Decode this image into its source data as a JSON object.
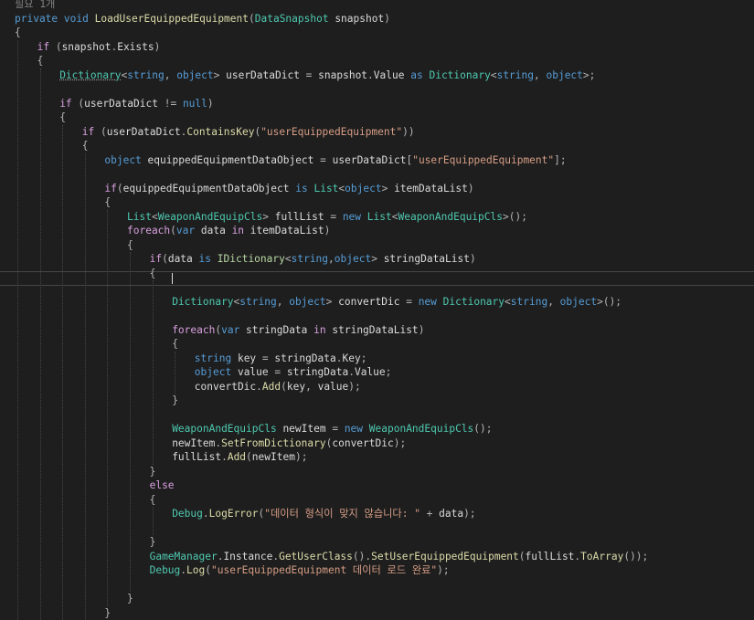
{
  "editor": {
    "lines": [
      {
        "n": 0,
        "indent": 0,
        "tokens": [
          {
            "t": "필요 1개",
            "c": "comment"
          }
        ]
      },
      {
        "n": 1,
        "indent": 0,
        "tokens": [
          {
            "t": "private",
            "c": "kw"
          },
          {
            "t": " ",
            "c": "txt"
          },
          {
            "t": "void",
            "c": "kw"
          },
          {
            "t": " ",
            "c": "txt"
          },
          {
            "t": "LoadUserEquippedEquipment",
            "c": "mth"
          },
          {
            "t": "(",
            "c": "pun"
          },
          {
            "t": "DataSnapshot",
            "c": "type"
          },
          {
            "t": " snapshot",
            "c": "var"
          },
          {
            "t": ")",
            "c": "pun"
          }
        ]
      },
      {
        "n": 2,
        "indent": 0,
        "tokens": [
          {
            "t": "{",
            "c": "pun"
          }
        ]
      },
      {
        "n": 3,
        "indent": 1,
        "tokens": [
          {
            "t": "if",
            "c": "ctl"
          },
          {
            "t": " (",
            "c": "pun"
          },
          {
            "t": "snapshot",
            "c": "var"
          },
          {
            "t": ".",
            "c": "pun"
          },
          {
            "t": "Exists",
            "c": "prop"
          },
          {
            "t": ")",
            "c": "pun"
          }
        ]
      },
      {
        "n": 4,
        "indent": 1,
        "tokens": [
          {
            "t": "{",
            "c": "pun"
          }
        ]
      },
      {
        "n": 5,
        "indent": 2,
        "tokens": [
          {
            "t": "Dictionary",
            "c": "type-sq"
          },
          {
            "t": "<",
            "c": "pun"
          },
          {
            "t": "string",
            "c": "kw"
          },
          {
            "t": ", ",
            "c": "pun"
          },
          {
            "t": "object",
            "c": "kw"
          },
          {
            "t": "> ",
            "c": "pun"
          },
          {
            "t": "userDataDict",
            "c": "var"
          },
          {
            "t": " = ",
            "c": "pun"
          },
          {
            "t": "snapshot",
            "c": "var"
          },
          {
            "t": ".",
            "c": "pun"
          },
          {
            "t": "Value",
            "c": "prop"
          },
          {
            "t": " ",
            "c": "txt"
          },
          {
            "t": "as",
            "c": "kw"
          },
          {
            "t": " ",
            "c": "txt"
          },
          {
            "t": "Dictionary",
            "c": "type"
          },
          {
            "t": "<",
            "c": "pun"
          },
          {
            "t": "string",
            "c": "kw"
          },
          {
            "t": ", ",
            "c": "pun"
          },
          {
            "t": "object",
            "c": "kw"
          },
          {
            "t": ">;",
            "c": "pun"
          }
        ]
      },
      {
        "n": 6,
        "indent": 2,
        "tokens": []
      },
      {
        "n": 7,
        "indent": 2,
        "tokens": [
          {
            "t": "if",
            "c": "ctl"
          },
          {
            "t": " (",
            "c": "pun"
          },
          {
            "t": "userDataDict",
            "c": "var"
          },
          {
            "t": " != ",
            "c": "pun"
          },
          {
            "t": "null",
            "c": "kw"
          },
          {
            "t": ")",
            "c": "pun"
          }
        ]
      },
      {
        "n": 8,
        "indent": 2,
        "tokens": [
          {
            "t": "{",
            "c": "pun"
          }
        ]
      },
      {
        "n": 9,
        "indent": 3,
        "tokens": [
          {
            "t": "if",
            "c": "ctl"
          },
          {
            "t": " (",
            "c": "pun"
          },
          {
            "t": "userDataDict",
            "c": "var"
          },
          {
            "t": ".",
            "c": "pun"
          },
          {
            "t": "ContainsKey",
            "c": "mth"
          },
          {
            "t": "(",
            "c": "pun"
          },
          {
            "t": "\"userEquippedEquipment\"",
            "c": "str"
          },
          {
            "t": "))",
            "c": "pun"
          }
        ]
      },
      {
        "n": 10,
        "indent": 3,
        "tokens": [
          {
            "t": "{",
            "c": "pun"
          }
        ]
      },
      {
        "n": 11,
        "indent": 4,
        "tokens": [
          {
            "t": "object",
            "c": "kw"
          },
          {
            "t": " equippedEquipmentDataObject",
            "c": "var"
          },
          {
            "t": " = ",
            "c": "pun"
          },
          {
            "t": "userDataDict",
            "c": "var"
          },
          {
            "t": "[",
            "c": "pun"
          },
          {
            "t": "\"userEquippedEquipment\"",
            "c": "str"
          },
          {
            "t": "];",
            "c": "pun"
          }
        ]
      },
      {
        "n": 12,
        "indent": 4,
        "tokens": []
      },
      {
        "n": 13,
        "indent": 4,
        "tokens": [
          {
            "t": "if",
            "c": "ctl"
          },
          {
            "t": "(",
            "c": "pun"
          },
          {
            "t": "equippedEquipmentDataObject",
            "c": "var"
          },
          {
            "t": " ",
            "c": "txt"
          },
          {
            "t": "is",
            "c": "kw"
          },
          {
            "t": " ",
            "c": "txt"
          },
          {
            "t": "List",
            "c": "type"
          },
          {
            "t": "<",
            "c": "pun"
          },
          {
            "t": "object",
            "c": "kw"
          },
          {
            "t": "> ",
            "c": "pun"
          },
          {
            "t": "itemDataList",
            "c": "var"
          },
          {
            "t": ")",
            "c": "pun"
          }
        ]
      },
      {
        "n": 14,
        "indent": 4,
        "tokens": [
          {
            "t": "{",
            "c": "pun"
          }
        ]
      },
      {
        "n": 15,
        "indent": 5,
        "tokens": [
          {
            "t": "List",
            "c": "type"
          },
          {
            "t": "<",
            "c": "pun"
          },
          {
            "t": "WeaponAndEquipCls",
            "c": "type"
          },
          {
            "t": "> ",
            "c": "pun"
          },
          {
            "t": "fullList",
            "c": "var"
          },
          {
            "t": " = ",
            "c": "pun"
          },
          {
            "t": "new",
            "c": "kw"
          },
          {
            "t": " ",
            "c": "txt"
          },
          {
            "t": "List",
            "c": "type"
          },
          {
            "t": "<",
            "c": "pun"
          },
          {
            "t": "WeaponAndEquipCls",
            "c": "type"
          },
          {
            "t": ">();",
            "c": "pun"
          }
        ]
      },
      {
        "n": 16,
        "indent": 5,
        "tokens": [
          {
            "t": "foreach",
            "c": "ctl"
          },
          {
            "t": "(",
            "c": "pun"
          },
          {
            "t": "var",
            "c": "kw"
          },
          {
            "t": " data",
            "c": "var"
          },
          {
            "t": " ",
            "c": "txt"
          },
          {
            "t": "in",
            "c": "ctl"
          },
          {
            "t": " itemDataList",
            "c": "var"
          },
          {
            "t": ")",
            "c": "pun"
          }
        ]
      },
      {
        "n": 17,
        "indent": 5,
        "tokens": [
          {
            "t": "{",
            "c": "pun"
          }
        ]
      },
      {
        "n": 18,
        "indent": 6,
        "tokens": [
          {
            "t": "if",
            "c": "ctl"
          },
          {
            "t": "(",
            "c": "pun"
          },
          {
            "t": "data",
            "c": "var"
          },
          {
            "t": " ",
            "c": "txt"
          },
          {
            "t": "is",
            "c": "kw"
          },
          {
            "t": " ",
            "c": "txt"
          },
          {
            "t": "IDictionary",
            "c": "iface"
          },
          {
            "t": "<",
            "c": "pun"
          },
          {
            "t": "string",
            "c": "kw"
          },
          {
            "t": ",",
            "c": "pun"
          },
          {
            "t": "object",
            "c": "kw"
          },
          {
            "t": "> ",
            "c": "pun"
          },
          {
            "t": "stringDataList",
            "c": "var"
          },
          {
            "t": ")",
            "c": "pun"
          }
        ]
      },
      {
        "n": 19,
        "indent": 6,
        "tokens": [
          {
            "t": "{",
            "c": "pun"
          }
        ]
      },
      {
        "n": 20,
        "indent": 7,
        "tokens": []
      },
      {
        "n": 21,
        "indent": 7,
        "tokens": [
          {
            "t": "Dictionary",
            "c": "type"
          },
          {
            "t": "<",
            "c": "pun"
          },
          {
            "t": "string",
            "c": "kw"
          },
          {
            "t": ", ",
            "c": "pun"
          },
          {
            "t": "object",
            "c": "kw"
          },
          {
            "t": "> ",
            "c": "pun"
          },
          {
            "t": "convertDic",
            "c": "var"
          },
          {
            "t": " = ",
            "c": "pun"
          },
          {
            "t": "new",
            "c": "kw"
          },
          {
            "t": " ",
            "c": "txt"
          },
          {
            "t": "Dictionary",
            "c": "type"
          },
          {
            "t": "<",
            "c": "pun"
          },
          {
            "t": "string",
            "c": "kw"
          },
          {
            "t": ", ",
            "c": "pun"
          },
          {
            "t": "object",
            "c": "kw"
          },
          {
            "t": ">();",
            "c": "pun"
          }
        ]
      },
      {
        "n": 22,
        "indent": 7,
        "tokens": []
      },
      {
        "n": 23,
        "indent": 7,
        "tokens": [
          {
            "t": "foreach",
            "c": "ctl"
          },
          {
            "t": "(",
            "c": "pun"
          },
          {
            "t": "var",
            "c": "kw"
          },
          {
            "t": " stringData",
            "c": "var"
          },
          {
            "t": " ",
            "c": "txt"
          },
          {
            "t": "in",
            "c": "ctl"
          },
          {
            "t": " stringDataList",
            "c": "var"
          },
          {
            "t": ")",
            "c": "pun"
          }
        ]
      },
      {
        "n": 24,
        "indent": 7,
        "tokens": [
          {
            "t": "{",
            "c": "pun"
          }
        ]
      },
      {
        "n": 25,
        "indent": 8,
        "tokens": [
          {
            "t": "string",
            "c": "kw"
          },
          {
            "t": " key",
            "c": "var"
          },
          {
            "t": " = ",
            "c": "pun"
          },
          {
            "t": "stringData",
            "c": "var"
          },
          {
            "t": ".",
            "c": "pun"
          },
          {
            "t": "Key",
            "c": "prop"
          },
          {
            "t": ";",
            "c": "pun"
          }
        ]
      },
      {
        "n": 26,
        "indent": 8,
        "tokens": [
          {
            "t": "object",
            "c": "kw"
          },
          {
            "t": " value",
            "c": "var"
          },
          {
            "t": " = ",
            "c": "pun"
          },
          {
            "t": "stringData",
            "c": "var"
          },
          {
            "t": ".",
            "c": "pun"
          },
          {
            "t": "Value",
            "c": "prop"
          },
          {
            "t": ";",
            "c": "pun"
          }
        ]
      },
      {
        "n": 27,
        "indent": 8,
        "tokens": [
          {
            "t": "convertDic",
            "c": "var"
          },
          {
            "t": ".",
            "c": "pun"
          },
          {
            "t": "Add",
            "c": "mth"
          },
          {
            "t": "(",
            "c": "pun"
          },
          {
            "t": "key",
            "c": "var"
          },
          {
            "t": ", ",
            "c": "pun"
          },
          {
            "t": "value",
            "c": "var"
          },
          {
            "t": ");",
            "c": "pun"
          }
        ]
      },
      {
        "n": 28,
        "indent": 7,
        "tokens": [
          {
            "t": "}",
            "c": "pun"
          }
        ]
      },
      {
        "n": 29,
        "indent": 7,
        "tokens": []
      },
      {
        "n": 30,
        "indent": 7,
        "tokens": [
          {
            "t": "WeaponAndEquipCls",
            "c": "type"
          },
          {
            "t": " newItem",
            "c": "var"
          },
          {
            "t": " = ",
            "c": "pun"
          },
          {
            "t": "new",
            "c": "kw"
          },
          {
            "t": " ",
            "c": "txt"
          },
          {
            "t": "WeaponAndEquipCls",
            "c": "type"
          },
          {
            "t": "();",
            "c": "pun"
          }
        ]
      },
      {
        "n": 31,
        "indent": 7,
        "tokens": [
          {
            "t": "newItem",
            "c": "var"
          },
          {
            "t": ".",
            "c": "pun"
          },
          {
            "t": "SetFromDictionary",
            "c": "mth"
          },
          {
            "t": "(",
            "c": "pun"
          },
          {
            "t": "convertDic",
            "c": "var"
          },
          {
            "t": ");",
            "c": "pun"
          }
        ]
      },
      {
        "n": 32,
        "indent": 7,
        "tokens": [
          {
            "t": "fullList",
            "c": "var"
          },
          {
            "t": ".",
            "c": "pun"
          },
          {
            "t": "Add",
            "c": "mth"
          },
          {
            "t": "(",
            "c": "pun"
          },
          {
            "t": "newItem",
            "c": "var"
          },
          {
            "t": ");",
            "c": "pun"
          }
        ]
      },
      {
        "n": 33,
        "indent": 6,
        "tokens": [
          {
            "t": "}",
            "c": "pun"
          }
        ]
      },
      {
        "n": 34,
        "indent": 6,
        "tokens": [
          {
            "t": "else",
            "c": "ctl"
          }
        ]
      },
      {
        "n": 35,
        "indent": 6,
        "tokens": [
          {
            "t": "{",
            "c": "pun"
          }
        ]
      },
      {
        "n": 36,
        "indent": 7,
        "tokens": [
          {
            "t": "Debug",
            "c": "type"
          },
          {
            "t": ".",
            "c": "pun"
          },
          {
            "t": "LogError",
            "c": "mth"
          },
          {
            "t": "(",
            "c": "pun"
          },
          {
            "t": "\"데이터 형식이 맞지 않습니다: \"",
            "c": "str"
          },
          {
            "t": " + ",
            "c": "pun"
          },
          {
            "t": "data",
            "c": "var"
          },
          {
            "t": ");",
            "c": "pun"
          }
        ]
      },
      {
        "n": 37,
        "indent": 7,
        "tokens": []
      },
      {
        "n": 38,
        "indent": 6,
        "tokens": [
          {
            "t": "}",
            "c": "pun"
          }
        ]
      },
      {
        "n": 39,
        "indent": 6,
        "tokens": [
          {
            "t": "GameManager",
            "c": "type"
          },
          {
            "t": ".",
            "c": "pun"
          },
          {
            "t": "Instance",
            "c": "prop"
          },
          {
            "t": ".",
            "c": "pun"
          },
          {
            "t": "GetUserClass",
            "c": "mth"
          },
          {
            "t": "().",
            "c": "pun"
          },
          {
            "t": "SetUserEquippedEquipment",
            "c": "mth"
          },
          {
            "t": "(",
            "c": "pun"
          },
          {
            "t": "fullList",
            "c": "var"
          },
          {
            "t": ".",
            "c": "pun"
          },
          {
            "t": "ToArray",
            "c": "mth"
          },
          {
            "t": "());",
            "c": "pun"
          }
        ]
      },
      {
        "n": 40,
        "indent": 6,
        "tokens": [
          {
            "t": "Debug",
            "c": "type"
          },
          {
            "t": ".",
            "c": "pun"
          },
          {
            "t": "Log",
            "c": "mth"
          },
          {
            "t": "(",
            "c": "pun"
          },
          {
            "t": "\"userEquippedEquipment 데이터 로드 완료\"",
            "c": "str"
          },
          {
            "t": ");",
            "c": "pun"
          }
        ]
      },
      {
        "n": 41,
        "indent": 6,
        "tokens": []
      },
      {
        "n": 42,
        "indent": 5,
        "tokens": [
          {
            "t": "}",
            "c": "pun"
          }
        ]
      },
      {
        "n": 43,
        "indent": 4,
        "tokens": [
          {
            "t": "}",
            "c": "pun"
          }
        ]
      }
    ]
  }
}
